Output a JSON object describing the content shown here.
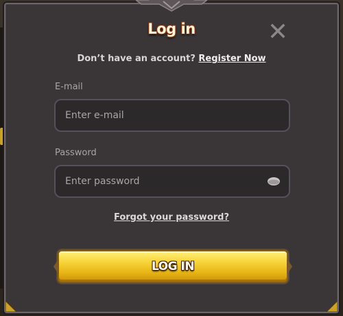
{
  "dialog": {
    "title": "Log in",
    "register_prompt": "Don’t have an account?",
    "register_link": "Register Now"
  },
  "email": {
    "label": "E-mail",
    "placeholder": "Enter e-mail",
    "value": ""
  },
  "password": {
    "label": "Password",
    "placeholder": "Enter password",
    "value": ""
  },
  "forgot_link": "Forgot your password?",
  "login_button": "LOG IN",
  "colors": {
    "modal_bg": "#3a3638",
    "button_gold": "#f7d43a",
    "title_text": "#fff2d6"
  },
  "icons": [
    "close-icon",
    "eye-icon",
    "top-ornament-icon"
  ]
}
